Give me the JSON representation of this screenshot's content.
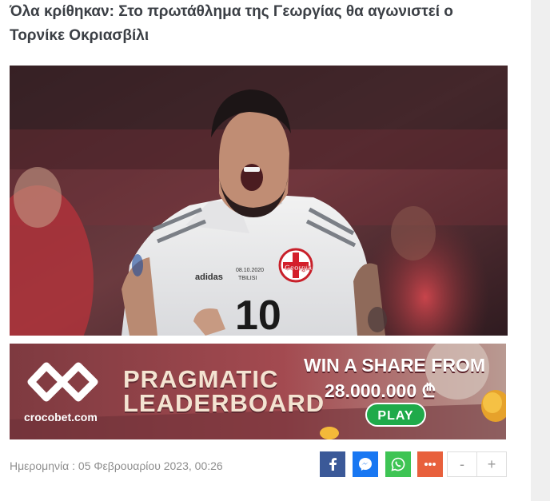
{
  "article": {
    "headline": "Όλα κρίθηκαν: Στο πρωτάθλημα της Γεωργίας θα αγωνιστεί ο Τορνίκε Οκριασβίλι",
    "hero_shirt_number": "10",
    "hero_shirt_text": "Georgia",
    "hero_match_text": "08.10.2020",
    "hero_city_text": "TBILISI",
    "hero_kit_brand": "adidas"
  },
  "banner": {
    "brand": "crocobet.com",
    "title_line1": "PRAGMATIC",
    "title_line2": "LEADERBOARD",
    "win_line": "WIN A SHARE FROM",
    "amount": "28.000.000 ₾",
    "play_label": "PLAY"
  },
  "meta": {
    "date_label": "Ημερομηνία :",
    "date_value": "05 Φεβρουαρίου 2023, 00:26"
  },
  "share": {
    "minus_label": "-",
    "plus_label": "+"
  },
  "colors": {
    "facebook": "#3b5998",
    "messenger": "#1877f2",
    "whatsapp": "#3ec454",
    "more": "#e8603c",
    "banner_bg": "#8d3f45"
  },
  "icons": [
    "facebook-icon",
    "messenger-icon",
    "whatsapp-icon",
    "more-icon"
  ]
}
